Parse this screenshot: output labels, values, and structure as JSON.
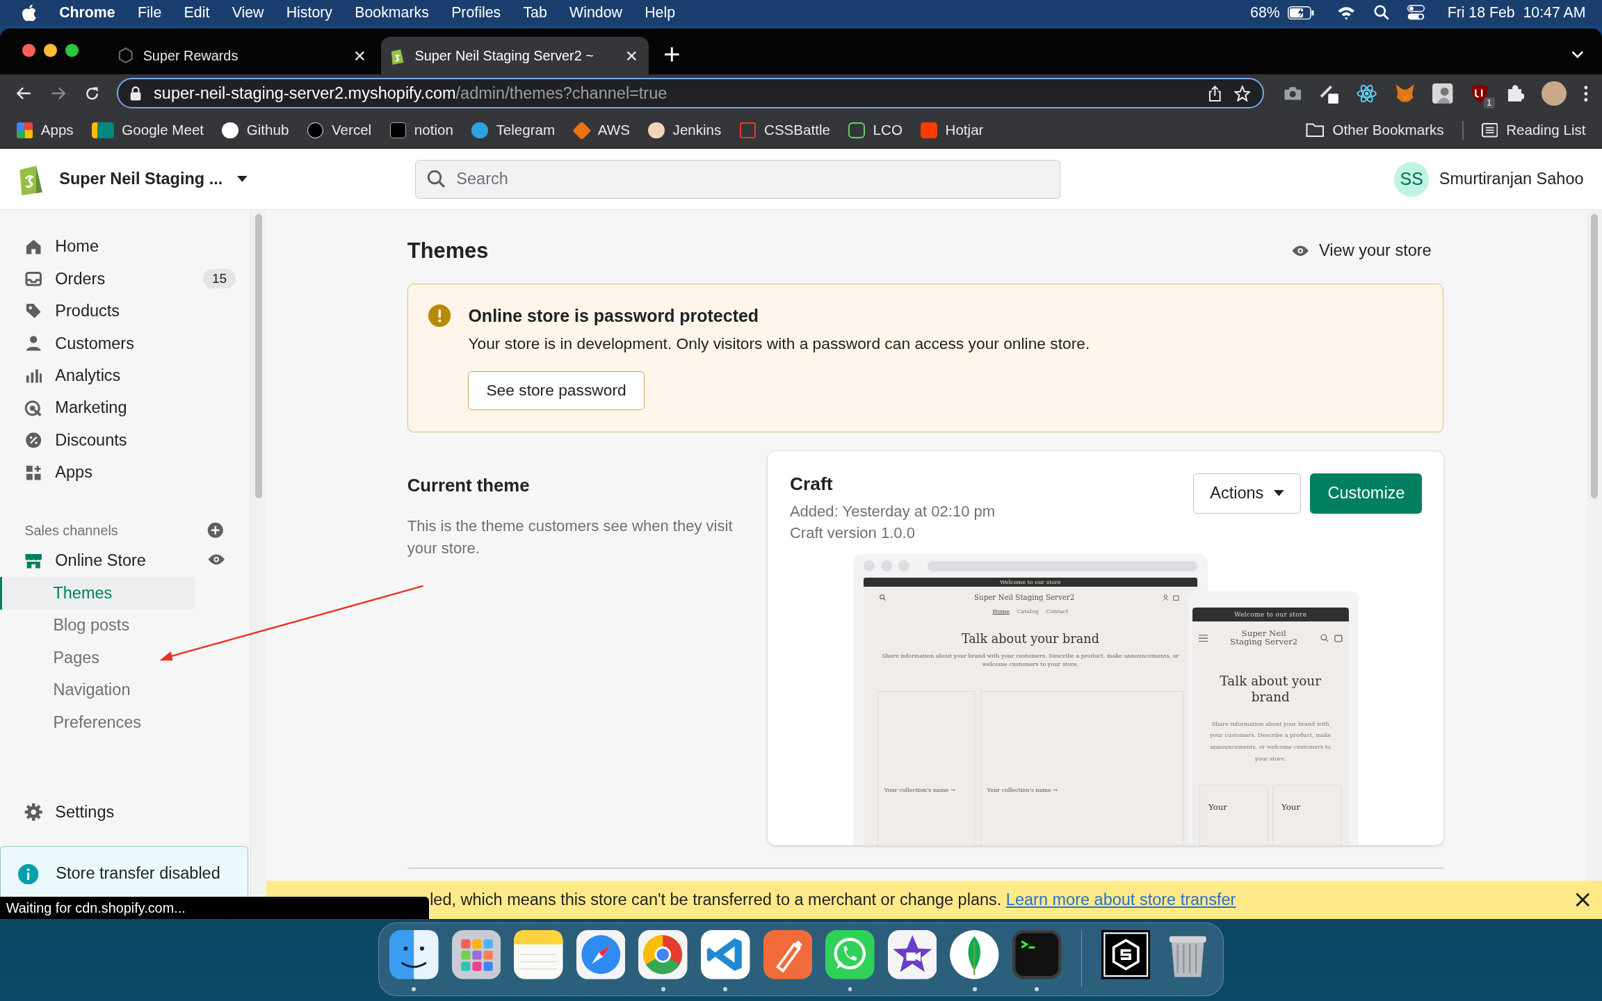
{
  "menu_bar": {
    "app": "Chrome",
    "items": [
      "File",
      "Edit",
      "View",
      "History",
      "Bookmarks",
      "Profiles",
      "Tab",
      "Window",
      "Help"
    ],
    "battery": "68%",
    "datetime": "Fri 18 Feb  10:47 AM"
  },
  "tabs": [
    {
      "title": "Super Rewards",
      "selected": false
    },
    {
      "title": "Super Neil Staging Server2 ~",
      "selected": true
    }
  ],
  "toolbar": {
    "forward_disabled": true,
    "host": "super-neil-staging-server2.myshopify.com",
    "path": "/admin/themes?channel=true",
    "extension_badge": "1"
  },
  "bookmarks": [
    {
      "label": "Apps"
    },
    {
      "label": "Google Meet"
    },
    {
      "label": "Github"
    },
    {
      "label": "Vercel"
    },
    {
      "label": "notion"
    },
    {
      "label": "Telegram"
    },
    {
      "label": "AWS"
    },
    {
      "label": "Jenkins"
    },
    {
      "label": "CSSBattle"
    },
    {
      "label": "LCO"
    },
    {
      "label": "Hotjar"
    }
  ],
  "bookmarks_right": [
    "Other Bookmarks",
    "Reading List"
  ],
  "shop_header": {
    "store_name": "Super Neil Staging ...",
    "search_placeholder": "Search",
    "avatar_initials": "SS",
    "user_name": "Smurtiranjan Sahoo"
  },
  "sidebar": {
    "items": [
      {
        "label": "Home"
      },
      {
        "label": "Orders",
        "badge": "15"
      },
      {
        "label": "Products"
      },
      {
        "label": "Customers"
      },
      {
        "label": "Analytics"
      },
      {
        "label": "Marketing"
      },
      {
        "label": "Discounts"
      },
      {
        "label": "Apps"
      }
    ],
    "sales_channels_label": "Sales channels",
    "channel": "Online Store",
    "sub_items": [
      {
        "label": "Themes",
        "selected": true
      },
      {
        "label": "Blog posts",
        "selected": false
      },
      {
        "label": "Pages",
        "selected": false
      },
      {
        "label": "Navigation",
        "selected": false
      },
      {
        "label": "Preferences",
        "selected": false
      }
    ],
    "settings": "Settings",
    "notice": "Store transfer disabled"
  },
  "page": {
    "title": "Themes",
    "view_store": "View your store",
    "alert": {
      "title": "Online store is password protected",
      "text": "Your store is in development. Only visitors with a password can access your online store.",
      "button": "See store password"
    },
    "current_theme": {
      "heading": "Current theme",
      "description": "This is the theme customers see when they visit your store."
    },
    "theme": {
      "name": "Craft",
      "added": "Added: Yesterday at 02:10 pm",
      "version": "Craft version 1.0.0",
      "actions": "Actions",
      "customize": "Customize"
    },
    "desktop_preview": {
      "announcement": "Welcome to our store",
      "store_name": "Super Neil Staging Server2",
      "nav": [
        {
          "label": "Home",
          "selected": true
        },
        {
          "label": "Catalog",
          "selected": false
        },
        {
          "label": "Contact",
          "selected": false
        }
      ],
      "heading": "Talk about your brand",
      "text": "Share information about your brand with your customers. Describe a product, make announcements, or welcome customers to your store.",
      "collections": [
        "Your collection's name →",
        "Your collection's name →"
      ]
    },
    "mobile_preview": {
      "announcement": "Welcome to our store",
      "store_name": "Super Neil Staging Server2",
      "heading": "Talk about your brand",
      "text": "Share information about your brand with your customers. Describe a product, make announcements, or welcome customers to your store.",
      "collections": [
        "Your",
        "Your"
      ]
    }
  },
  "banner": {
    "text": "led, which means this store can't be transferred to a merchant or change plans.",
    "link": "Learn more about store transfer"
  },
  "status_tooltip": "Waiting for cdn.shopify.com...",
  "dock": [
    {
      "running": true
    },
    {
      "running": false
    },
    {
      "running": false
    },
    {
      "running": false
    },
    {
      "running": true
    },
    {
      "running": true
    },
    {
      "running": false
    },
    {
      "running": true
    },
    {
      "running": false
    },
    {
      "running": true
    },
    {
      "running": true
    },
    {
      "running": false
    },
    {
      "running": false
    }
  ]
}
